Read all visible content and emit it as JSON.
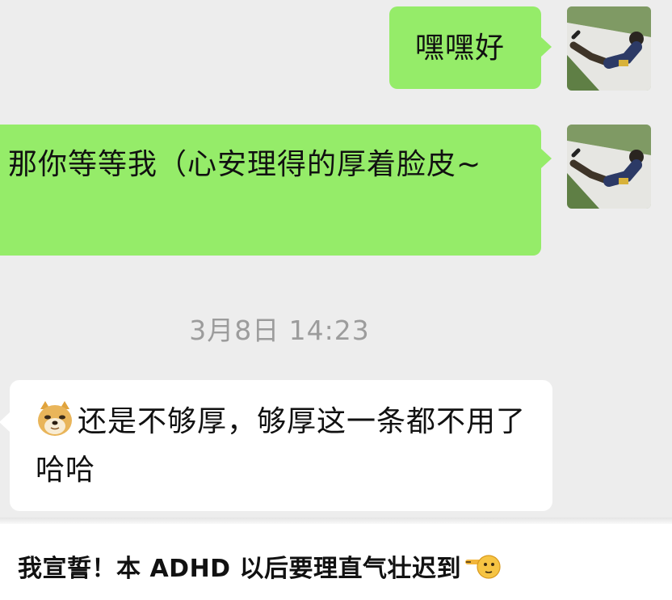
{
  "chat": {
    "messages": [
      {
        "sender": "self",
        "text": "嘿嘿好"
      },
      {
        "sender": "self",
        "text": "那你等等我（心安理得的厚着脸皮~"
      },
      {
        "sender": "other",
        "text": "还是不够厚，够厚这一条都不用了哈哈",
        "emoji": "doge-emoji"
      }
    ],
    "timestamp": "3月8日 14:23"
  },
  "caption": {
    "text": "我宣誓！本 ADHD 以后要理直气壮迟到",
    "emoji": "pointing-left-emoji"
  },
  "colors": {
    "chat_background": "#ededed",
    "self_bubble": "#95ec69",
    "other_bubble": "#ffffff",
    "timestamp_text": "#9c9c9c"
  },
  "icons": {
    "avatar": "avatar-photo-person-lying-on-steps",
    "doge": "doge-emoji",
    "point": "pointing-left-emoji"
  }
}
